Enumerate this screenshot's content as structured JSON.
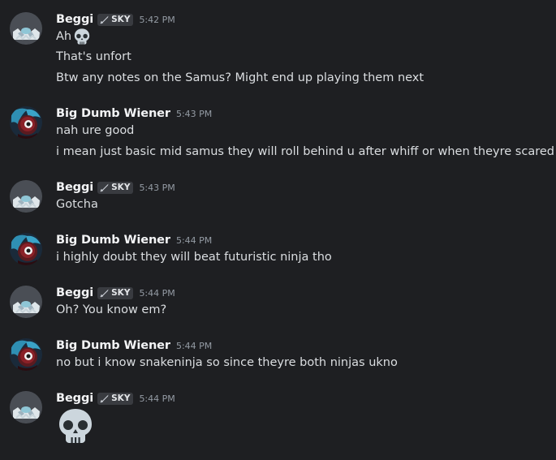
{
  "messages": [
    {
      "author": "Beggi",
      "tag": "SKY",
      "time": "5:42 PM",
      "lines": [
        "Ah",
        "That's unfort",
        "Btw any notes on the Samus? Might end up playing them next"
      ]
    },
    {
      "author": "Big Dumb Wiener",
      "time": "5:43 PM",
      "lines": [
        "nah ure good",
        "i mean just basic mid samus they will roll behind u after whiff or when theyre scared"
      ]
    },
    {
      "author": "Beggi",
      "tag": "SKY",
      "time": "5:43 PM",
      "lines": [
        "Gotcha"
      ]
    },
    {
      "author": "Big Dumb Wiener",
      "time": "5:44 PM",
      "lines": [
        "i highly doubt they will beat futuristic ninja tho"
      ]
    },
    {
      "author": "Beggi",
      "tag": "SKY",
      "time": "5:44 PM",
      "lines": [
        "Oh? You know em?"
      ]
    },
    {
      "author": "Big Dumb Wiener",
      "time": "5:44 PM",
      "lines": [
        "no but i know snakeninja so since theyre both ninjas ukno"
      ]
    },
    {
      "author": "Beggi",
      "tag": "SKY",
      "time": "5:44 PM",
      "lines": []
    }
  ],
  "icons": {
    "inline_emoji": "skull-emoji-icon",
    "big_emoji": "skull-emoji-icon",
    "tag_icon": "swords-icon"
  },
  "colors": {
    "background": "#1e1f22",
    "username": "#f2f3f5",
    "text": "#dbdee1",
    "timestamp": "#949ba4",
    "tag_bg": "#393b40"
  }
}
